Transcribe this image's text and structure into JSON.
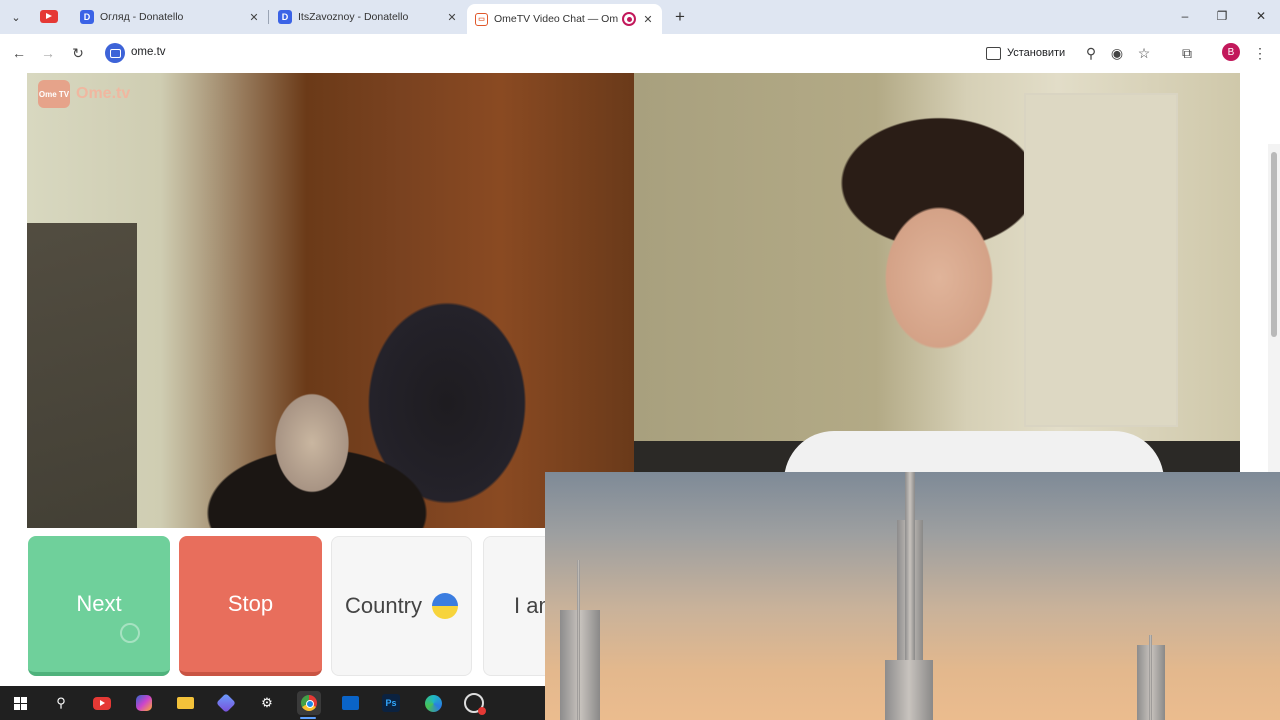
{
  "tabs": [
    {
      "title": "Огляд - Donatello",
      "favicon": "D",
      "favicon_color": "#3b63e6"
    },
    {
      "title": "ItsZavoznoy - Donatello",
      "favicon": "D",
      "favicon_color": "#3b63e6"
    },
    {
      "title": "OmeTV Video Chat — Ome",
      "favicon": "O",
      "favicon_color": "#e0582b"
    }
  ],
  "window": {
    "new_tab_label": "+",
    "minimize_label": "–",
    "maximize_label": "❐",
    "close_label": "✕"
  },
  "toolbar": {
    "url": "ome.tv",
    "install_label": "Установити",
    "profile_initial": "B"
  },
  "video": {
    "logo_badge": "Ome TV",
    "logo_text": "Ome.tv"
  },
  "controls": {
    "next_label": "Next",
    "stop_label": "Stop",
    "country_label": "Country",
    "country_flag": "ukraine-flag",
    "iam_label": "I am"
  },
  "taskbar": {
    "items": [
      "windows-start",
      "search",
      "youtube",
      "copilot",
      "file-explorer",
      "app",
      "settings",
      "chrome",
      "outlook",
      "photoshop",
      "edge",
      "obs"
    ]
  },
  "colors": {
    "next": "#6fd09b",
    "stop": "#e86e5c",
    "accent": "#3d63d8"
  }
}
